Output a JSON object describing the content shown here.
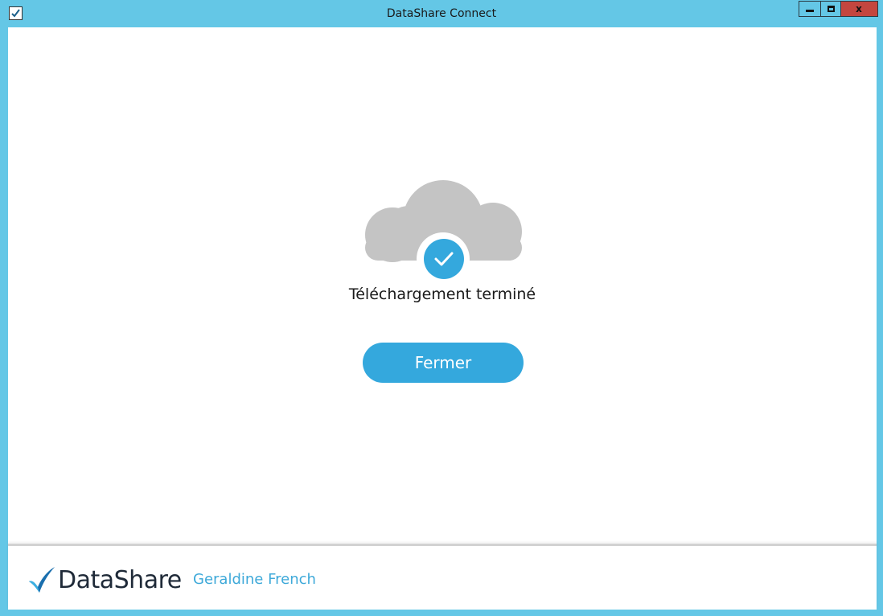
{
  "window": {
    "title": "DataShare Connect",
    "close_glyph": "x",
    "colors": {
      "frame": "#64c7e6",
      "accent": "#34a8dd",
      "close_button": "#c4463f",
      "cloud": "#c4c4c4"
    }
  },
  "icons": {
    "app": "datashare-check-icon",
    "cloud": "cloud-icon",
    "status": "checkmark-icon",
    "logo": "datashare-logo-swoosh-icon"
  },
  "main": {
    "status_text": "Téléchargement terminé",
    "close_button_label": "Fermer"
  },
  "footer": {
    "brand_name": "DataShare",
    "user_name": "Geraldine French"
  }
}
